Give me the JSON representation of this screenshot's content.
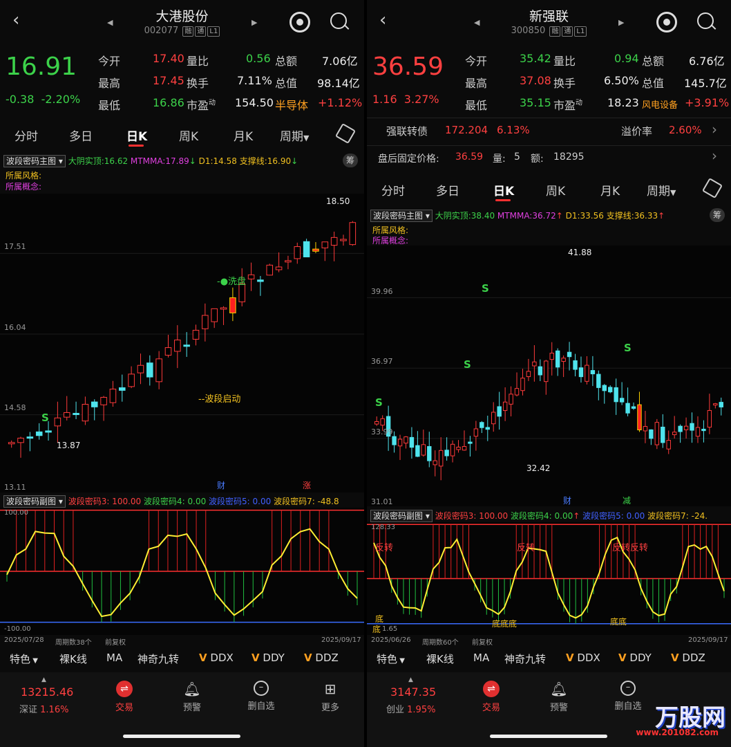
{
  "panels": [
    {
      "id": "L",
      "title": "大港股份",
      "code": "002077",
      "tags": [
        "融",
        "通",
        "L1"
      ],
      "price": "16.91",
      "change": "-0.38",
      "change_pct": "-2.20%",
      "price_color": "#3cd24a",
      "quotes": {
        "open_label": "今开",
        "open": "17.40",
        "high_label": "最高",
        "high": "17.45",
        "low_label": "最低",
        "low": "16.86",
        "vr_label": "量比",
        "vr": "0.56",
        "turn_label": "换手",
        "turn": "7.11%",
        "pe_label": "市盈",
        "pe_sup": "动",
        "pe": "154.50",
        "amt_label": "总额",
        "amt": "7.06亿",
        "cap_label": "总值",
        "cap": "98.14亿",
        "sector": "半导体",
        "sector_chg": "+1.12%"
      },
      "extra_rows": [],
      "tabs": [
        "分时",
        "多日",
        "日K",
        "周K",
        "月K",
        "周期"
      ],
      "active_tab": 2,
      "main_indicator": "波段密码主图",
      "main_legend": {
        "a": "大阴实顶:16.62",
        "b": "MTMMA:17.89",
        "b_arrow": "↓",
        "c": "D1:14.58",
        "d": "支撑线:16.90",
        "d_arrow": "↓"
      },
      "style_label": "所属风格:",
      "concept_label": "所属概念:",
      "y_ticks": [
        "17.51",
        "16.04",
        "14.58",
        "13.11"
      ],
      "annotations": {
        "high": "18.50",
        "low": "13.87",
        "wash": "-●洗盘",
        "start": "--波段启动",
        "s": "S",
        "cai": "财",
        "zhang": "涨"
      },
      "sub_indicator": "波段密码副图",
      "sub_legend": {
        "a": "波段密码3: 100.00",
        "b": "波段密码4: 0.00",
        "c": "波段密码5: 0.00",
        "d": "波段密码7: -48.8"
      },
      "sub_ticks": [
        "100.00",
        "-100.00"
      ],
      "sub_labels": [],
      "date_start": "2025/07/28",
      "period_count": "周期数38个",
      "adjust": "前复权",
      "date_end": "2025/09/17",
      "tools": [
        "特色",
        "裸K线",
        "MA",
        "神奇九转",
        "DDX",
        "DDY",
        "DDZ"
      ],
      "tool_mark": "V",
      "index_value": "13215.46",
      "index_name": "深证",
      "index_chg": "1.16%",
      "bottom": [
        "交易",
        "预警",
        "删自选",
        "更多"
      ],
      "chou": "筹"
    },
    {
      "id": "R",
      "title": "新强联",
      "code": "300850",
      "tags": [
        "融",
        "通",
        "L1"
      ],
      "price": "36.59",
      "change": "1.16",
      "change_pct": "3.27%",
      "price_color": "#ff4040",
      "quotes": {
        "open_label": "今开",
        "open": "35.42",
        "high_label": "最高",
        "high": "37.08",
        "low_label": "最低",
        "low": "35.15",
        "vr_label": "量比",
        "vr": "0.94",
        "turn_label": "换手",
        "turn": "6.50%",
        "pe_label": "市盈",
        "pe_sup": "动",
        "pe": "18.23",
        "amt_label": "总额",
        "amt": "6.76亿",
        "cap_label": "总值",
        "cap": "145.7亿",
        "sector": "风电设备",
        "sector_chg": "+3.91%"
      },
      "extra_rows": [
        {
          "a": "强联转债",
          "b": "172.204",
          "c": "6.13%",
          "d": "溢价率",
          "e": "2.60%"
        },
        {
          "a": "盘后固定价格:",
          "b": "36.59",
          "c": "量:",
          "d": "5",
          "e": "额:",
          "f": "18295"
        }
      ],
      "tabs": [
        "分时",
        "多日",
        "日K",
        "周K",
        "月K",
        "周期"
      ],
      "active_tab": 2,
      "main_indicator": "波段密码主图",
      "main_legend": {
        "a": "大阴实顶:38.40",
        "b": "MTMMA:36.72",
        "b_arrow": "↑",
        "c": "D1:33.56",
        "d": "支撑线:36.33",
        "d_arrow": "↑"
      },
      "style_label": "所属风格:",
      "concept_label": "所属概念:",
      "y_ticks": [
        "39.96",
        "36.97",
        "33.99",
        "31.01"
      ],
      "annotations": {
        "high": "41.88",
        "low": "32.42",
        "s": "S",
        "cai": "财",
        "jian": "减"
      },
      "sub_indicator": "波段密码副图",
      "sub_legend": {
        "a": "波段密码3: 100.00",
        "b": "波段密码4: 0.00",
        "b_arrow": "↑",
        "c": "波段密码5: 0.00",
        "d": "波段密码7: -24."
      },
      "sub_ticks": [
        "128.33",
        "1.65"
      ],
      "sub_labels": [
        "反转",
        "反转",
        "反转反转",
        "底",
        "底",
        "底底底",
        "底底"
      ],
      "date_start": "2025/06/26",
      "period_count": "周期数60个",
      "adjust": "前复权",
      "date_end": "2025/09/17",
      "tools": [
        "特色",
        "裸K线",
        "MA",
        "神奇九转",
        "DDX",
        "DDY",
        "DDZ"
      ],
      "tool_mark": "V",
      "index_value": "3147.35",
      "index_name": "创业",
      "index_chg": "1.95%",
      "bottom": [
        "交易",
        "预警",
        "删自选",
        "更多"
      ],
      "chou": "筹"
    }
  ],
  "watermark": {
    "brand": "万股网",
    "url": "www.201082.com"
  }
}
